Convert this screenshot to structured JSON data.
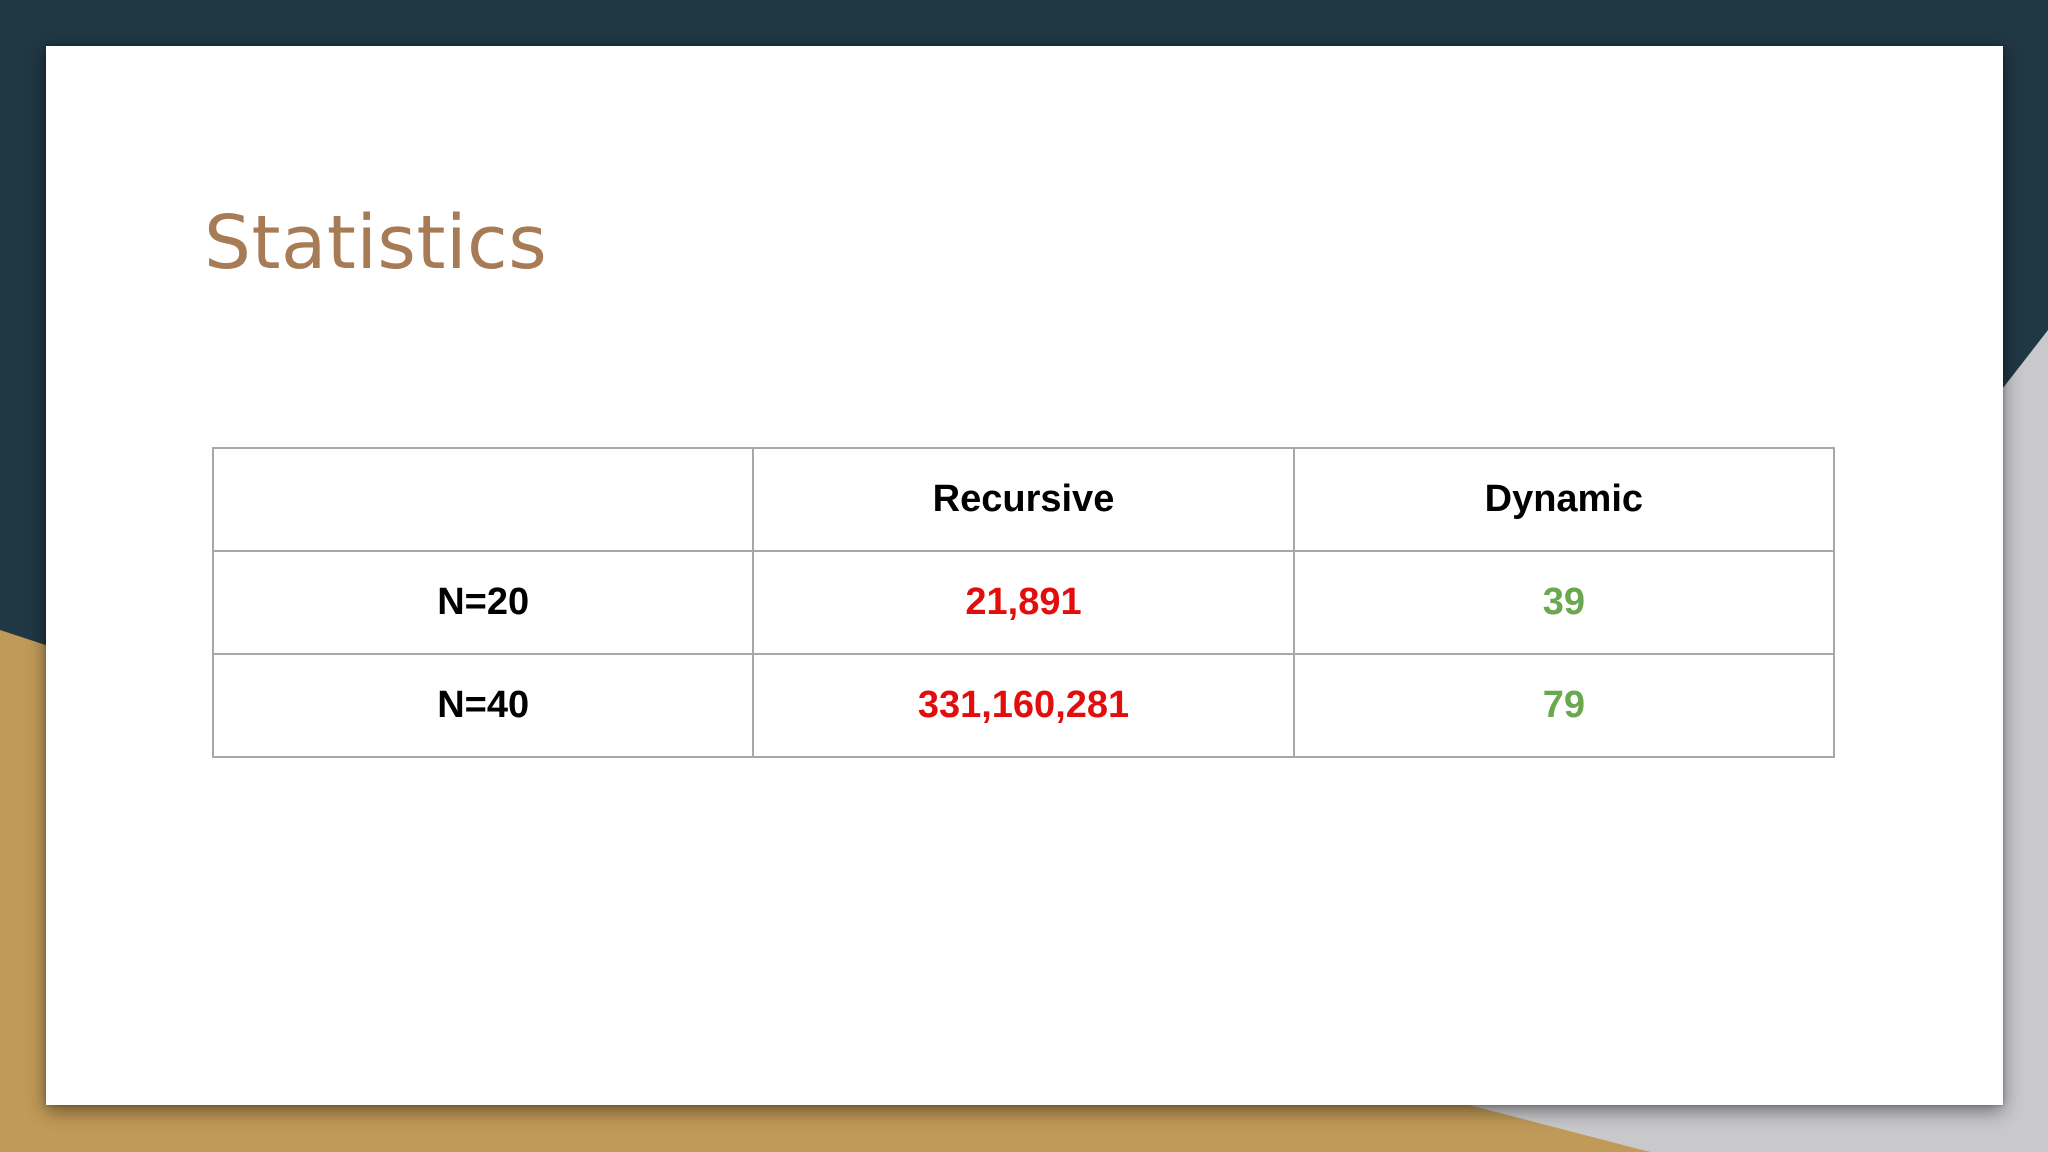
{
  "slide": {
    "title": "Statistics"
  },
  "table": {
    "headers": [
      "",
      "Recursive",
      "Dynamic"
    ],
    "rows": [
      {
        "label": "N=20",
        "recursive": "21,891",
        "dynamic": "39"
      },
      {
        "label": "N=40",
        "recursive": "331,160,281",
        "dynamic": "79"
      }
    ]
  },
  "colors": {
    "title": "#a67b56",
    "recursive_values": "#e30d0d",
    "dynamic_values": "#6aa84f",
    "backdrop_dark": "#203744",
    "backdrop_gold": "#c09a58",
    "backdrop_gray": "#c9c9cc"
  }
}
